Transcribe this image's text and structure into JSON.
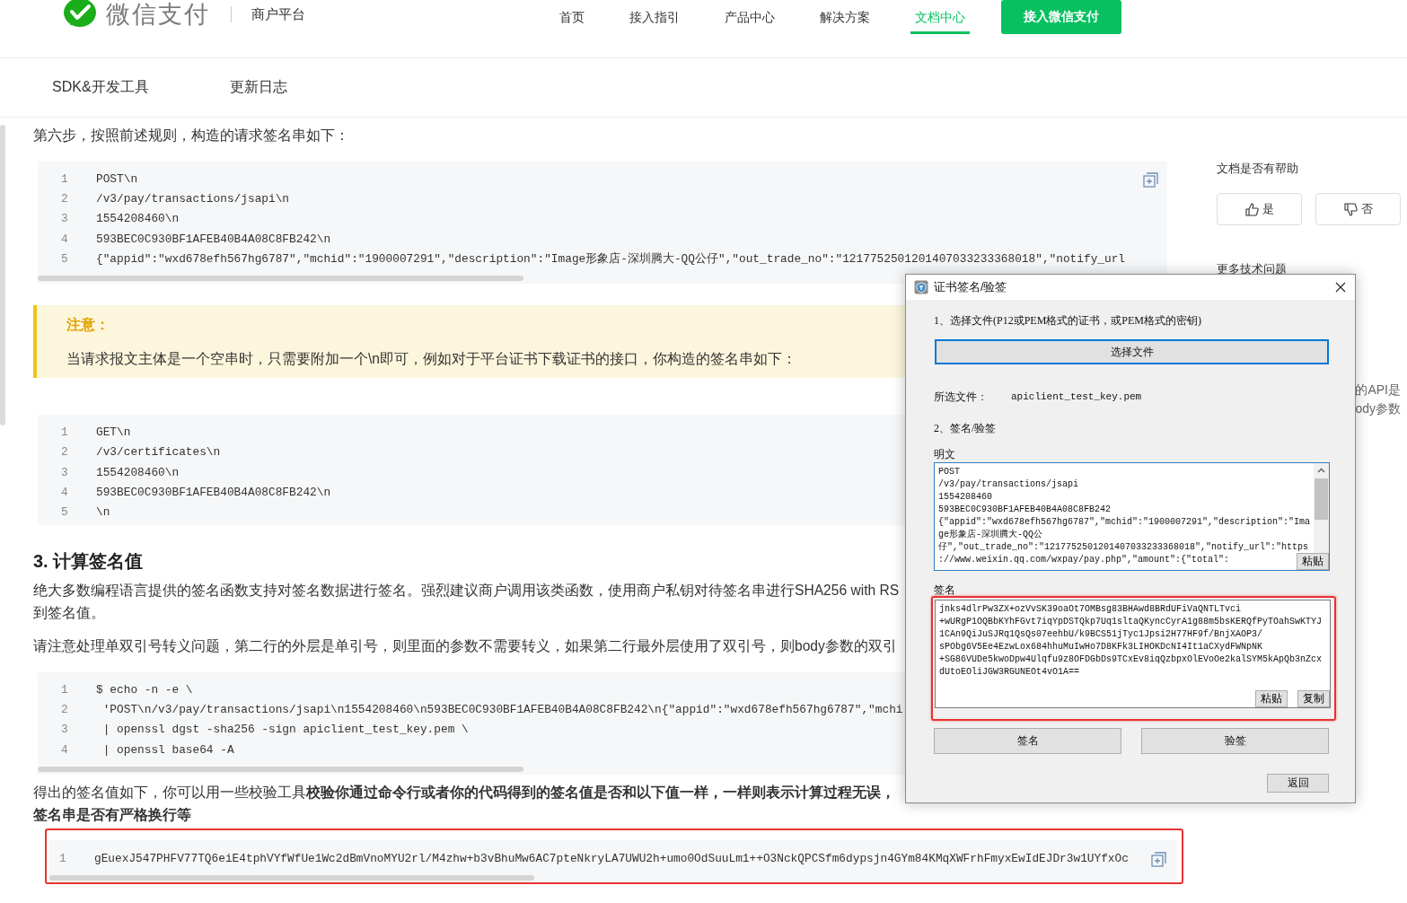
{
  "header": {
    "brand": "微信支付",
    "platform": "商户平台",
    "nav": [
      {
        "label": "首页",
        "selected": false
      },
      {
        "label": "接入指引",
        "selected": false
      },
      {
        "label": "产品中心",
        "selected": false
      },
      {
        "label": "解决方案",
        "selected": false
      },
      {
        "label": "文档中心",
        "selected": true
      }
    ],
    "cta": "接入微信支付"
  },
  "subnav": [
    {
      "label": "SDK&开发工具"
    },
    {
      "label": "更新日志"
    }
  ],
  "content": [
    {
      "kind": "paragraph",
      "lines": [
        "第六步，按照前述规则，构造的请求签名串如下："
      ]
    },
    {
      "kind": "code",
      "copy_button": true,
      "scrollbar": true,
      "highlighted": false,
      "lines": [
        {
          "number": "1",
          "text": "POST\\n"
        },
        {
          "number": "2",
          "text": "/v3/pay/transactions/jsapi\\n"
        },
        {
          "number": "3",
          "text": "1554208460\\n"
        },
        {
          "number": "4",
          "text": "593BEC0C930BF1AFEB40B4A08C8FB242\\n"
        },
        {
          "number": "5",
          "text": "{\"appid\":\"wxd678efh567hg6787\",\"mchid\":\"1900007291\",\"description\":\"Image形象店-深圳腾大-QQ公仔\",\"out_trade_no\":\"1217752501201407033233368018\",\"notify_url"
        }
      ]
    },
    {
      "kind": "note",
      "title": "注意：",
      "text": "当请求报文主体是一个空串时，只需要附加一个\\n即可，例如对于平台证书下载证书的接口，你构造的签名串如下："
    },
    {
      "kind": "code",
      "scrollbar": false,
      "highlighted": false,
      "lines": [
        {
          "number": "1",
          "text": "GET\\n"
        },
        {
          "number": "2",
          "text": "/v3/certificates\\n"
        },
        {
          "number": "3",
          "text": "1554208460\\n"
        },
        {
          "number": "4",
          "text": "593BEC0C930BF1AFEB40B4A08C8FB242\\n"
        },
        {
          "number": "5",
          "text": "\\n"
        }
      ]
    },
    {
      "kind": "heading",
      "text": "3. 计算签名值"
    },
    {
      "kind": "paragraph",
      "lines": [
        "绝大多数编程语言提供的签名函数支持对签名数据进行签名。强烈建议商户调用该类函数，使用商户私钥对待签名串进行SHA256 with RS",
        "到签名值。"
      ]
    },
    {
      "kind": "paragraph",
      "lines": [
        "请注意处理单双引号转义问题，第二行的外层是单引号，则里面的参数不需要转义，如果第二行最外层使用了双引号，则body参数的双引"
      ]
    },
    {
      "kind": "code",
      "scrollbar": true,
      "highlighted": false,
      "lines": [
        {
          "number": "1",
          "text": "$ echo -n -e \\"
        },
        {
          "number": "2",
          "text": " 'POST\\n/v3/pay/transactions/jsapi\\n1554208460\\n593BEC0C930BF1AFEB40B4A08C8FB242\\n{\"appid\":\"wxd678efh567hg6787\",\"mchi"
        },
        {
          "number": "3",
          "text": " | openssl dgst -sha256 -sign apiclient_test_key.pem \\"
        },
        {
          "number": "4",
          "text": " | openssl base64 -A"
        }
      ]
    },
    {
      "kind": "paragraph",
      "lines": [
        "得出的签名值如下，你可以用一些校验工具**校验你通过命令行或者你的代码得到的签名值是否和以下值一样，一样则表示计算过程无误，**",
        "**签名串是否有严格换行等**"
      ]
    },
    {
      "kind": "code",
      "copy_button": true,
      "scrollbar": true,
      "highlighted": true,
      "lines": [
        {
          "number": "1",
          "text": "gEuexJ547PHFV77TQ6eiE4tphVYfWfUe1Wc2dBmVnoMYU2rl/M4zhw+b3vBhuMw6AC7pteNkryLA7UWU2h+umo0OdSuuLm1++O3NckQPCSfm6dypsjn4GYm84KMqXWFrhFmyxEwIdEJDr3w1UYfxOc"
        }
      ]
    }
  ],
  "sidebar": {
    "help_title": "文档是否有帮助",
    "feedback": [
      {
        "kind": "like",
        "label": "是"
      },
      {
        "kind": "dislike",
        "label": "否"
      }
    ],
    "more_title": "更多技术问题",
    "snippets": [
      "的API是",
      "ody参数"
    ]
  },
  "dialog": {
    "title": "证书签名/验签",
    "step1_label": "1、选择文件(P12或PEM格式的证书，或PEM格式的密钥)",
    "choose_button": {
      "label": "选择文件",
      "focused": true
    },
    "selected_file_label": "所选文件：",
    "selected_file": "apiclient_test_key.pem",
    "step2_label": "2、签名/验签",
    "plaintext": {
      "label": "明文",
      "buttons": [
        "粘贴"
      ],
      "lines": [
        "POST",
        "/v3/pay/transactions/jsapi",
        "1554208460",
        "593BEC0C930BF1AFEB40B4A08C8FB242",
        "{\"appid\":\"wxd678efh567hg6787\",\"mchid\":\"1900007291\",\"description\":\"Ima",
        "ge形象店-深圳腾大-QQ公",
        "仔\",\"out_trade_no\":\"1217752501201407033233368018\",\"notify_url\":\"https",
        "://www.weixin.qq.com/wxpay/pay.php\",\"amount\":{\"total\":"
      ]
    },
    "signature": {
      "label": "签名",
      "highlighted": true,
      "buttons": [
        "粘贴",
        "复制"
      ],
      "lines": [
        "jnks4dlrPw3ZX+ozVvSK39oaOt7OMBsg83BHAwd8BRdUFiVaQNTLTvci",
        "+wURgP1OQBbKYhFGvt7iqYpDSTQkp7Uq1sltaQKyncCyrA1g88m5bsKERQfPyTOahSwKTYJ",
        "1CAn9QiJuSJRq1QsQs07eehbU/k9BCS51jTyc1Jpsi2H77HF9f/BnjXAOP3/",
        "sPObg6V5Ee4EzwLox684hhuMuIwHo7D8KFk3LIHOKDcNI4It1aCXydFWNpNK",
        "+SG86VUDe5kwoDpw4Ulqfu9z8OFDGbDs9TCxEv8iqQzbpxOlEVoOe2kalSYM5kApQb3nZcx",
        "dUtoEOliJGW3RGUNEOt4vO1A=="
      ]
    },
    "actions": [
      "签名",
      "验签"
    ],
    "back_button": "返回"
  }
}
